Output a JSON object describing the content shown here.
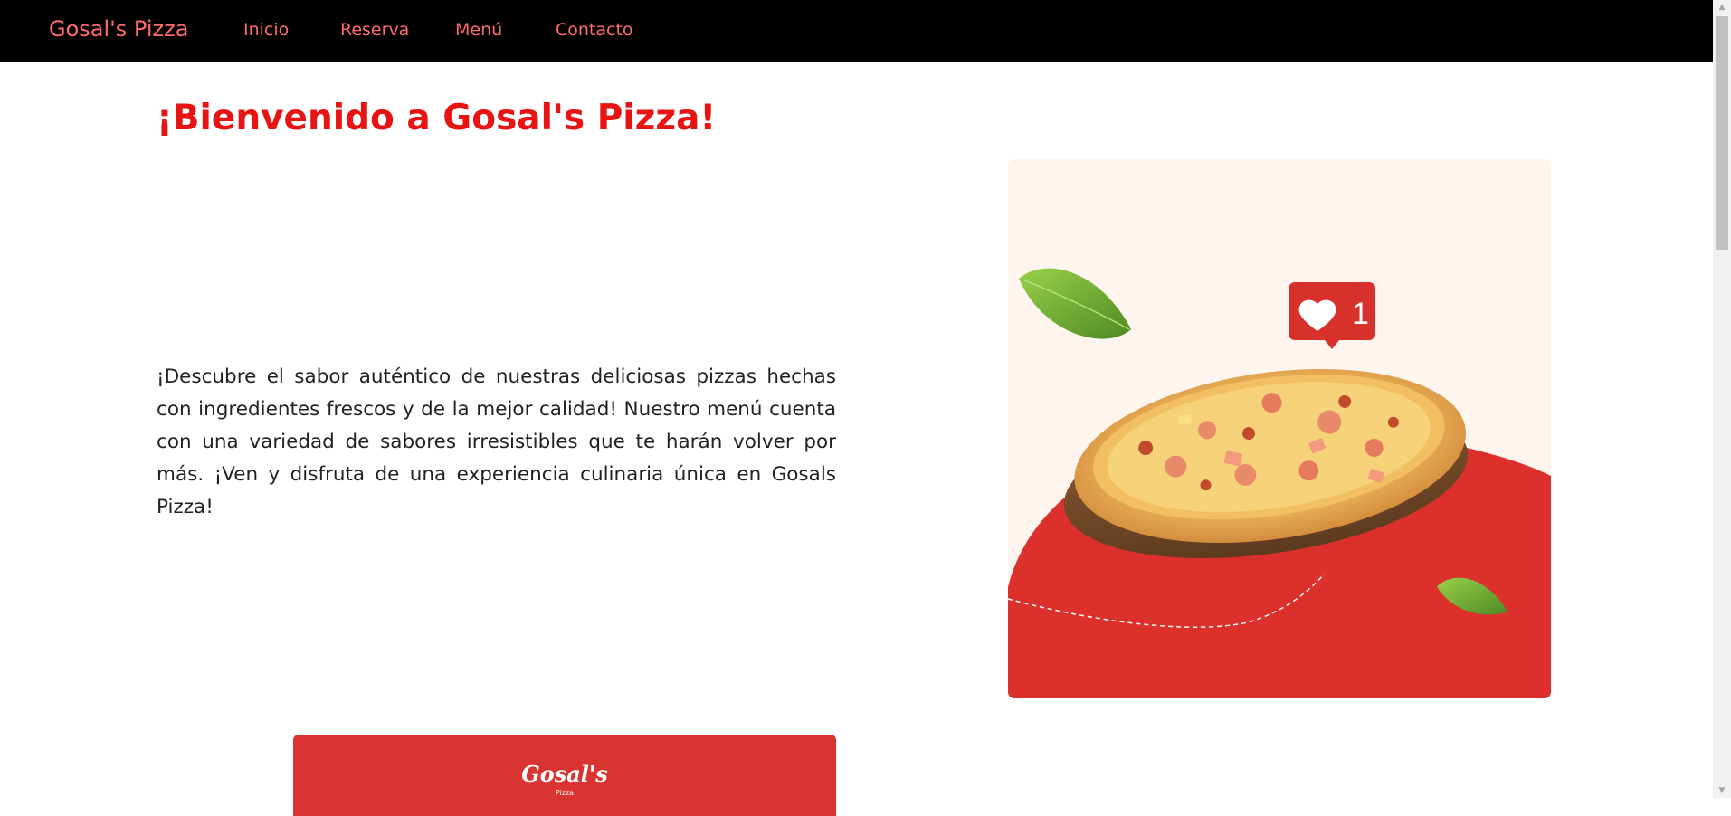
{
  "nav": {
    "brand": "Gosal's Pizza",
    "links": [
      "Inicio",
      "Reserva",
      "Menú",
      "Contacto"
    ]
  },
  "hero": {
    "title": "¡Bienvenido a Gosal's Pizza!",
    "description": "¡Descubre el sabor auténtico de nuestras deliciosas pizzas hechas con ingredientes frescos y de la mejor calidad! Nuestro menú cuenta con una variedad de sabores irresistibles que te harán volver por más. ¡Ven y disfruta de una experiencia culinaria única en Gosals Pizza!",
    "image": {
      "like_count": "1",
      "icons": [
        "heart-icon",
        "basil-leaf-icon",
        "pizza-image"
      ]
    }
  },
  "promo": {
    "logo_text": "Gosal's",
    "logo_subtext": "Pizza"
  },
  "colors": {
    "navbar_bg": "#000000",
    "nav_link": "#ff6b6b",
    "title": "#e81313",
    "card_red": "#d93431",
    "card_cream": "#fdf5ee"
  }
}
